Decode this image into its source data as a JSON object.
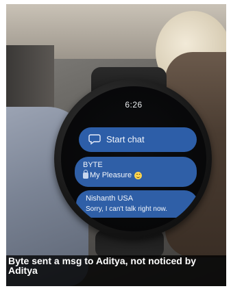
{
  "watch_screen": {
    "time": "6:26",
    "start_chat": {
      "label": "Start chat",
      "icon": "chat-bubble-icon"
    },
    "conversations": [
      {
        "name": "BYTE",
        "message": "My Pleasure",
        "prefix_icon": "lock-icon",
        "suffix_icon": "smile-emoji-icon"
      },
      {
        "name": "Nishanth USA",
        "message": "Sorry, I can't talk right now."
      }
    ],
    "colors": {
      "pill_blue": "#2f5fa7",
      "screen_black": "#050506"
    }
  },
  "caption": {
    "text": "Byte sent a msg to Aditya,  not noticed by Aditya"
  }
}
